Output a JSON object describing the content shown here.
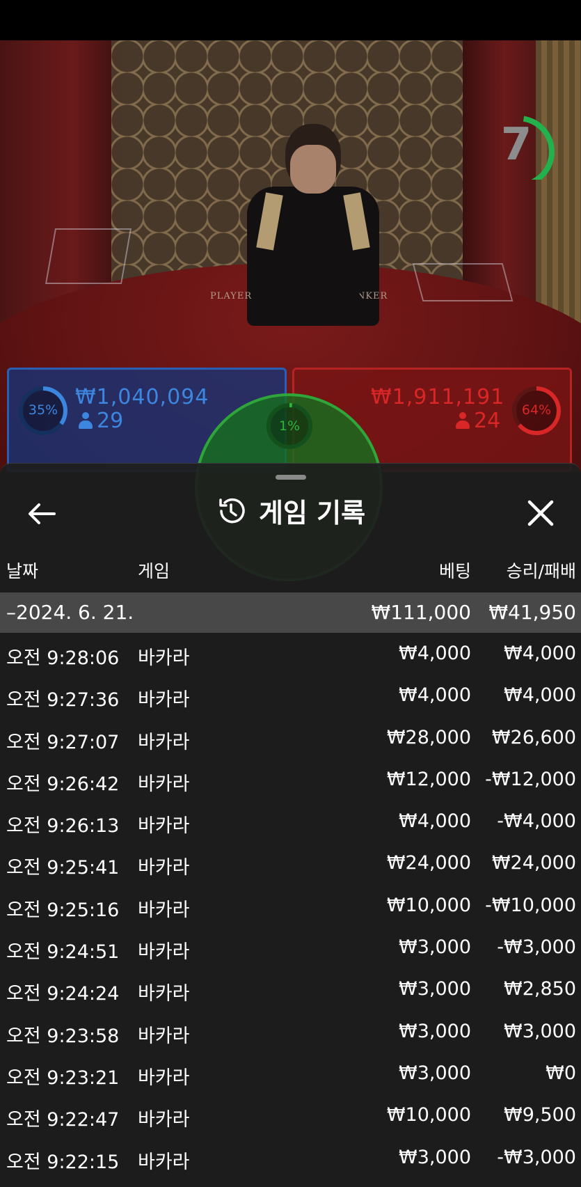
{
  "video": {
    "timer": "7",
    "table_player_text": "PLAYER",
    "table_banker_text": "BANKER"
  },
  "bets": {
    "player": {
      "percent": "35%",
      "percent_value": 35,
      "amount": "₩1,040,094",
      "count": "29",
      "color": "#3d86e0"
    },
    "banker": {
      "percent": "64%",
      "percent_value": 64,
      "amount": "₩1,911,191",
      "count": "24",
      "color": "#d92626"
    },
    "tie": {
      "percent": "1%",
      "percent_value": 1,
      "color": "#31b43e"
    }
  },
  "sheet": {
    "title": "게임 기록",
    "icons": {
      "back": "arrow-left-icon",
      "history": "history-icon",
      "close": "close-icon"
    },
    "columns": {
      "date": "날짜",
      "game": "게임",
      "bet": "베팅",
      "result": "승리/패배"
    },
    "day": {
      "label": "–2024. 6. 21.",
      "bet_total": "₩111,000",
      "result_total": "₩41,950"
    },
    "rows": [
      {
        "time": "오전 9:28:06",
        "game": "바카라",
        "bet": "₩4,000",
        "result": "₩4,000"
      },
      {
        "time": "오전 9:27:36",
        "game": "바카라",
        "bet": "₩4,000",
        "result": "₩4,000"
      },
      {
        "time": "오전 9:27:07",
        "game": "바카라",
        "bet": "₩28,000",
        "result": "₩26,600"
      },
      {
        "time": "오전 9:26:42",
        "game": "바카라",
        "bet": "₩12,000",
        "result": "-₩12,000"
      },
      {
        "time": "오전 9:26:13",
        "game": "바카라",
        "bet": "₩4,000",
        "result": "-₩4,000"
      },
      {
        "time": "오전 9:25:41",
        "game": "바카라",
        "bet": "₩24,000",
        "result": "₩24,000"
      },
      {
        "time": "오전 9:25:16",
        "game": "바카라",
        "bet": "₩10,000",
        "result": "-₩10,000"
      },
      {
        "time": "오전 9:24:51",
        "game": "바카라",
        "bet": "₩3,000",
        "result": "-₩3,000"
      },
      {
        "time": "오전 9:24:24",
        "game": "바카라",
        "bet": "₩3,000",
        "result": "₩2,850"
      },
      {
        "time": "오전 9:23:58",
        "game": "바카라",
        "bet": "₩3,000",
        "result": "₩3,000"
      },
      {
        "time": "오전 9:23:21",
        "game": "바카라",
        "bet": "₩3,000",
        "result": "₩0"
      },
      {
        "time": "오전 9:22:47",
        "game": "바카라",
        "bet": "₩10,000",
        "result": "₩9,500"
      },
      {
        "time": "오전 9:22:15",
        "game": "바카라",
        "bet": "₩3,000",
        "result": "-₩3,000"
      }
    ]
  }
}
